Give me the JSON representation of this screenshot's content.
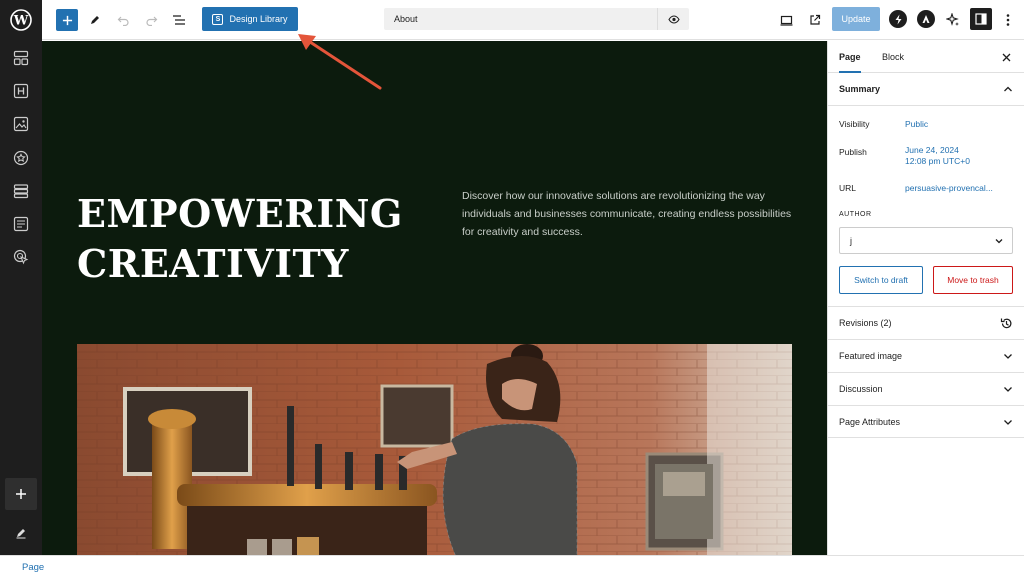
{
  "toolbar": {
    "design_library_label": "Design Library",
    "design_library_icon_letter": "S",
    "document_title": "About",
    "update_label": "Update"
  },
  "hero": {
    "title_line1": "EMPOWERING",
    "title_line2": "CREATIVITY",
    "text": "Discover how our innovative solutions are revolutionizing the way individuals and businesses communicate, creating endless possibilities for creativity and success."
  },
  "panel": {
    "tabs": [
      {
        "label": "Page",
        "active": true
      },
      {
        "label": "Block",
        "active": false
      }
    ],
    "summary": {
      "title": "Summary",
      "visibility_label": "Visibility",
      "visibility_value": "Public",
      "publish_label": "Publish",
      "publish_date": "June 24, 2024",
      "publish_time": "12:08 pm UTC+0",
      "url_label": "URL",
      "url_value": "persuasive-provencal...",
      "author_label": "AUTHOR",
      "author_value": "j",
      "switch_draft_label": "Switch to draft",
      "move_trash_label": "Move to trash"
    },
    "sections": [
      {
        "label": "Revisions (2)",
        "icon": "history-icon"
      },
      {
        "label": "Featured image",
        "icon": "chevron-down-icon"
      },
      {
        "label": "Discussion",
        "icon": "chevron-down-icon"
      },
      {
        "label": "Page Attributes",
        "icon": "chevron-down-icon"
      }
    ]
  },
  "footer": {
    "breadcrumb": "Page"
  },
  "colors": {
    "accent": "#2271b1",
    "canvas_bg": "#0c1b0d",
    "sidebar_bg": "#1e1e1e",
    "annotation_arrow": "#e4553a",
    "danger": "#cc1818"
  }
}
